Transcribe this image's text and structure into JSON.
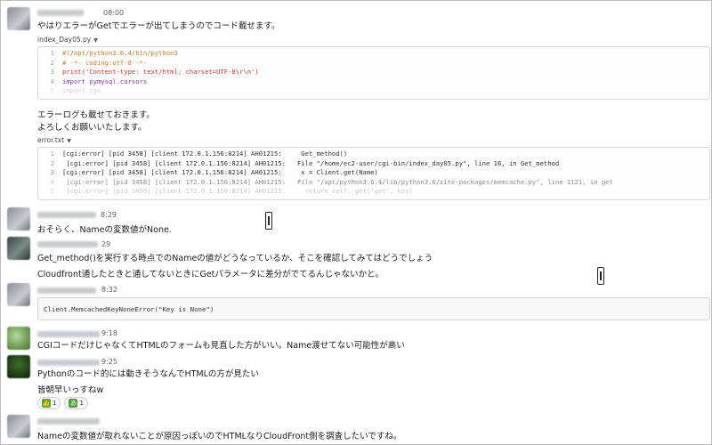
{
  "messages": [
    {
      "time": "08:00",
      "lines": [
        "やはりエラーがGetでエラーが出てしまうのでコード載せます。"
      ]
    },
    {
      "lines": [
        "エラーログも載せておきます。",
        "よろしくお願いいたします。"
      ]
    },
    {
      "time": "8:29",
      "lines": [
        "おそらく、Nameの変数値がNone."
      ]
    },
    {
      "time": "29",
      "lines": [
        "Get_method()を実行する時点でのNameの値がどうなっているか、そこを確認してみてはどうでしょう",
        "Cloudfront通したときと通してないときにGetパラメータに差分がでてるんじゃないかと。"
      ]
    },
    {
      "time": "8:32",
      "snippet": "Client.MemcachedKeyNoneError(\"Key is None\")"
    },
    {
      "time": "9:18",
      "lines": [
        "CGIコードだけじゃなくてHTMLのフォームも見直した方がいい。Name渡せてない可能性が高い"
      ]
    },
    {
      "time": "9:25",
      "lines": [
        "Pythonのコード的には動きそうなんでHTMLの方が見たい",
        "皆朝早いっすねw"
      ]
    },
    {
      "lines": [
        "Nameの変数値が取れないことが原因っぽいのでHTMLなりCloudFront側を調査したいですね。"
      ]
    }
  ],
  "file1": {
    "name": "index_Day05.py",
    "lines": [
      {
        "n": "1",
        "t": "#!/opt/python3.6.4/bin/python3"
      },
      {
        "n": "2",
        "t": "# -*- coding:utf-8 -*-"
      },
      {
        "n": "3",
        "t": "print('Content-type: text/html; charset=UTF-8\\r\\n')"
      },
      {
        "n": "4",
        "t": "import pymysql.cursors"
      },
      {
        "n": "5",
        "t": "import cgi"
      }
    ]
  },
  "file2": {
    "name": "error.txt",
    "lines": [
      {
        "n": "1",
        "t": "[cgi:error] [pid 3458] [client 172.0.1.156:8214] AH01215:     Get_method()"
      },
      {
        "n": "2",
        "t": " [cgi:error] [pid 3458] [client 172.0.1.156:8214] AH01215:   File \"/home/ec2-user/cgi-bin/index_day05.py\", line 16, in Get_method"
      },
      {
        "n": "3",
        "t": "[cgi:error] [pid 3458] [client 172.0.1.156:8214] AH01215:     x = Client.get(Name)"
      },
      {
        "n": "4",
        "t": " [cgi:error] [pid 3458] [client 172.0.1.156:8214] AH01215:   File \"/opt/python3.6.4/lib/python3.6/site-packages/memcache.py\", line 1121, in get"
      },
      {
        "n": "5",
        "t": " [cgi:error] [pid 3458] [client 172.0.1.156:8214] AH01215:     return self._get('get', key)"
      }
    ]
  },
  "reactions": [
    {
      "emoji": "+1",
      "count": "1"
    },
    {
      "emoji": "ok",
      "count": "1"
    }
  ]
}
